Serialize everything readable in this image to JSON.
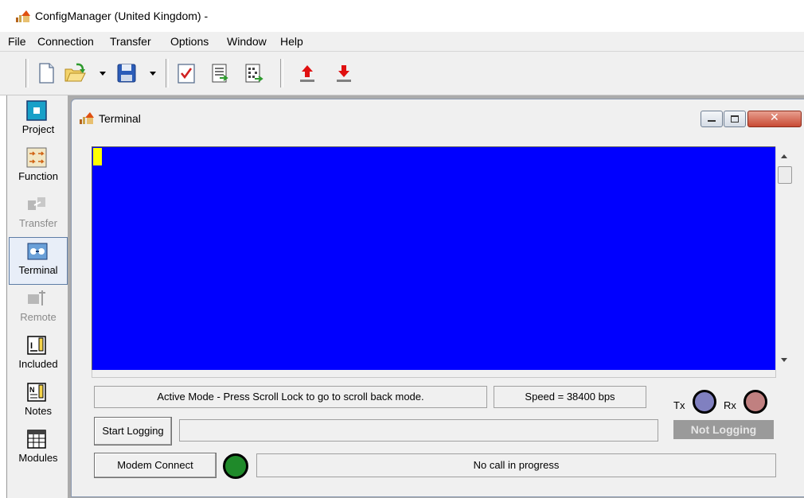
{
  "window": {
    "title": "ConfigManager (United Kingdom) -"
  },
  "menu": [
    "File",
    "Connection",
    "Transfer",
    "Options",
    "Window",
    "Help"
  ],
  "toolbar": {
    "icons": [
      "new-document-icon",
      "open-folder-icon",
      "save-disk-icon",
      "check-document-icon",
      "properties-icon",
      "binary-document-icon",
      "upload-arrow-icon",
      "download-arrow-icon"
    ]
  },
  "sidebar": {
    "items": [
      {
        "label": "Project",
        "icon": "project-icon",
        "enabled": true
      },
      {
        "label": "Function",
        "icon": "function-icon",
        "enabled": true
      },
      {
        "label": "Transfer",
        "icon": "transfer-icon",
        "enabled": false
      },
      {
        "label": "Terminal",
        "icon": "terminal-icon",
        "enabled": true,
        "selected": true
      },
      {
        "label": "Remote",
        "icon": "remote-icon",
        "enabled": false
      },
      {
        "label": "Included",
        "icon": "included-icon",
        "enabled": true
      },
      {
        "label": "Notes",
        "icon": "notes-icon",
        "enabled": true
      },
      {
        "label": "Modules",
        "icon": "modules-icon",
        "enabled": true
      }
    ]
  },
  "terminal": {
    "title": "Terminal",
    "background": "#0000ff",
    "cursor_color": "#ffff00",
    "status_mode": "Active Mode - Press Scroll Lock to go to scroll back mode.",
    "speed": "Speed = 38400 bps",
    "tx_label": "Tx",
    "rx_label": "Rx",
    "tx_color": "#8080c0",
    "rx_color": "#c08080",
    "start_logging_label": "Start Logging",
    "logging_path": "",
    "logging_status": "Not Logging",
    "modem_connect_label": "Modem Connect",
    "modem_led_color": "#1f8a2a",
    "call_status": "No call in progress"
  }
}
